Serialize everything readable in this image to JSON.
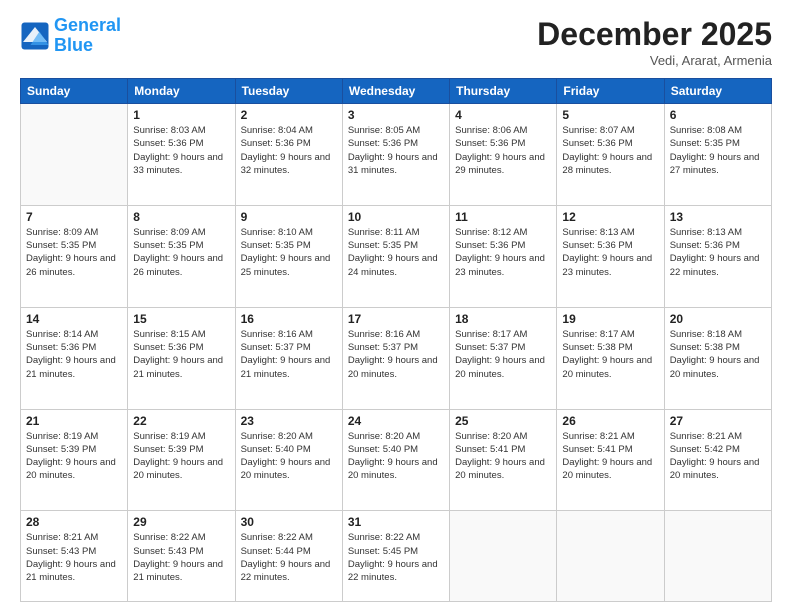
{
  "header": {
    "logo_line1": "General",
    "logo_line2": "Blue",
    "month": "December 2025",
    "location": "Vedi, Ararat, Armenia"
  },
  "weekdays": [
    "Sunday",
    "Monday",
    "Tuesday",
    "Wednesday",
    "Thursday",
    "Friday",
    "Saturday"
  ],
  "weeks": [
    [
      {
        "day": "",
        "empty": true
      },
      {
        "day": "1",
        "sunrise": "8:03 AM",
        "sunset": "5:36 PM",
        "daylight": "9 hours and 33 minutes."
      },
      {
        "day": "2",
        "sunrise": "8:04 AM",
        "sunset": "5:36 PM",
        "daylight": "9 hours and 32 minutes."
      },
      {
        "day": "3",
        "sunrise": "8:05 AM",
        "sunset": "5:36 PM",
        "daylight": "9 hours and 31 minutes."
      },
      {
        "day": "4",
        "sunrise": "8:06 AM",
        "sunset": "5:36 PM",
        "daylight": "9 hours and 29 minutes."
      },
      {
        "day": "5",
        "sunrise": "8:07 AM",
        "sunset": "5:36 PM",
        "daylight": "9 hours and 28 minutes."
      },
      {
        "day": "6",
        "sunrise": "8:08 AM",
        "sunset": "5:35 PM",
        "daylight": "9 hours and 27 minutes."
      }
    ],
    [
      {
        "day": "7",
        "sunrise": "8:09 AM",
        "sunset": "5:35 PM",
        "daylight": "9 hours and 26 minutes."
      },
      {
        "day": "8",
        "sunrise": "8:09 AM",
        "sunset": "5:35 PM",
        "daylight": "9 hours and 26 minutes."
      },
      {
        "day": "9",
        "sunrise": "8:10 AM",
        "sunset": "5:35 PM",
        "daylight": "9 hours and 25 minutes."
      },
      {
        "day": "10",
        "sunrise": "8:11 AM",
        "sunset": "5:35 PM",
        "daylight": "9 hours and 24 minutes."
      },
      {
        "day": "11",
        "sunrise": "8:12 AM",
        "sunset": "5:36 PM",
        "daylight": "9 hours and 23 minutes."
      },
      {
        "day": "12",
        "sunrise": "8:13 AM",
        "sunset": "5:36 PM",
        "daylight": "9 hours and 23 minutes."
      },
      {
        "day": "13",
        "sunrise": "8:13 AM",
        "sunset": "5:36 PM",
        "daylight": "9 hours and 22 minutes."
      }
    ],
    [
      {
        "day": "14",
        "sunrise": "8:14 AM",
        "sunset": "5:36 PM",
        "daylight": "9 hours and 21 minutes."
      },
      {
        "day": "15",
        "sunrise": "8:15 AM",
        "sunset": "5:36 PM",
        "daylight": "9 hours and 21 minutes."
      },
      {
        "day": "16",
        "sunrise": "8:16 AM",
        "sunset": "5:37 PM",
        "daylight": "9 hours and 21 minutes."
      },
      {
        "day": "17",
        "sunrise": "8:16 AM",
        "sunset": "5:37 PM",
        "daylight": "9 hours and 20 minutes."
      },
      {
        "day": "18",
        "sunrise": "8:17 AM",
        "sunset": "5:37 PM",
        "daylight": "9 hours and 20 minutes."
      },
      {
        "day": "19",
        "sunrise": "8:17 AM",
        "sunset": "5:38 PM",
        "daylight": "9 hours and 20 minutes."
      },
      {
        "day": "20",
        "sunrise": "8:18 AM",
        "sunset": "5:38 PM",
        "daylight": "9 hours and 20 minutes."
      }
    ],
    [
      {
        "day": "21",
        "sunrise": "8:19 AM",
        "sunset": "5:39 PM",
        "daylight": "9 hours and 20 minutes."
      },
      {
        "day": "22",
        "sunrise": "8:19 AM",
        "sunset": "5:39 PM",
        "daylight": "9 hours and 20 minutes."
      },
      {
        "day": "23",
        "sunrise": "8:20 AM",
        "sunset": "5:40 PM",
        "daylight": "9 hours and 20 minutes."
      },
      {
        "day": "24",
        "sunrise": "8:20 AM",
        "sunset": "5:40 PM",
        "daylight": "9 hours and 20 minutes."
      },
      {
        "day": "25",
        "sunrise": "8:20 AM",
        "sunset": "5:41 PM",
        "daylight": "9 hours and 20 minutes."
      },
      {
        "day": "26",
        "sunrise": "8:21 AM",
        "sunset": "5:41 PM",
        "daylight": "9 hours and 20 minutes."
      },
      {
        "day": "27",
        "sunrise": "8:21 AM",
        "sunset": "5:42 PM",
        "daylight": "9 hours and 20 minutes."
      }
    ],
    [
      {
        "day": "28",
        "sunrise": "8:21 AM",
        "sunset": "5:43 PM",
        "daylight": "9 hours and 21 minutes."
      },
      {
        "day": "29",
        "sunrise": "8:22 AM",
        "sunset": "5:43 PM",
        "daylight": "9 hours and 21 minutes."
      },
      {
        "day": "30",
        "sunrise": "8:22 AM",
        "sunset": "5:44 PM",
        "daylight": "9 hours and 22 minutes."
      },
      {
        "day": "31",
        "sunrise": "8:22 AM",
        "sunset": "5:45 PM",
        "daylight": "9 hours and 22 minutes."
      },
      {
        "day": "",
        "empty": true
      },
      {
        "day": "",
        "empty": true
      },
      {
        "day": "",
        "empty": true
      }
    ]
  ]
}
